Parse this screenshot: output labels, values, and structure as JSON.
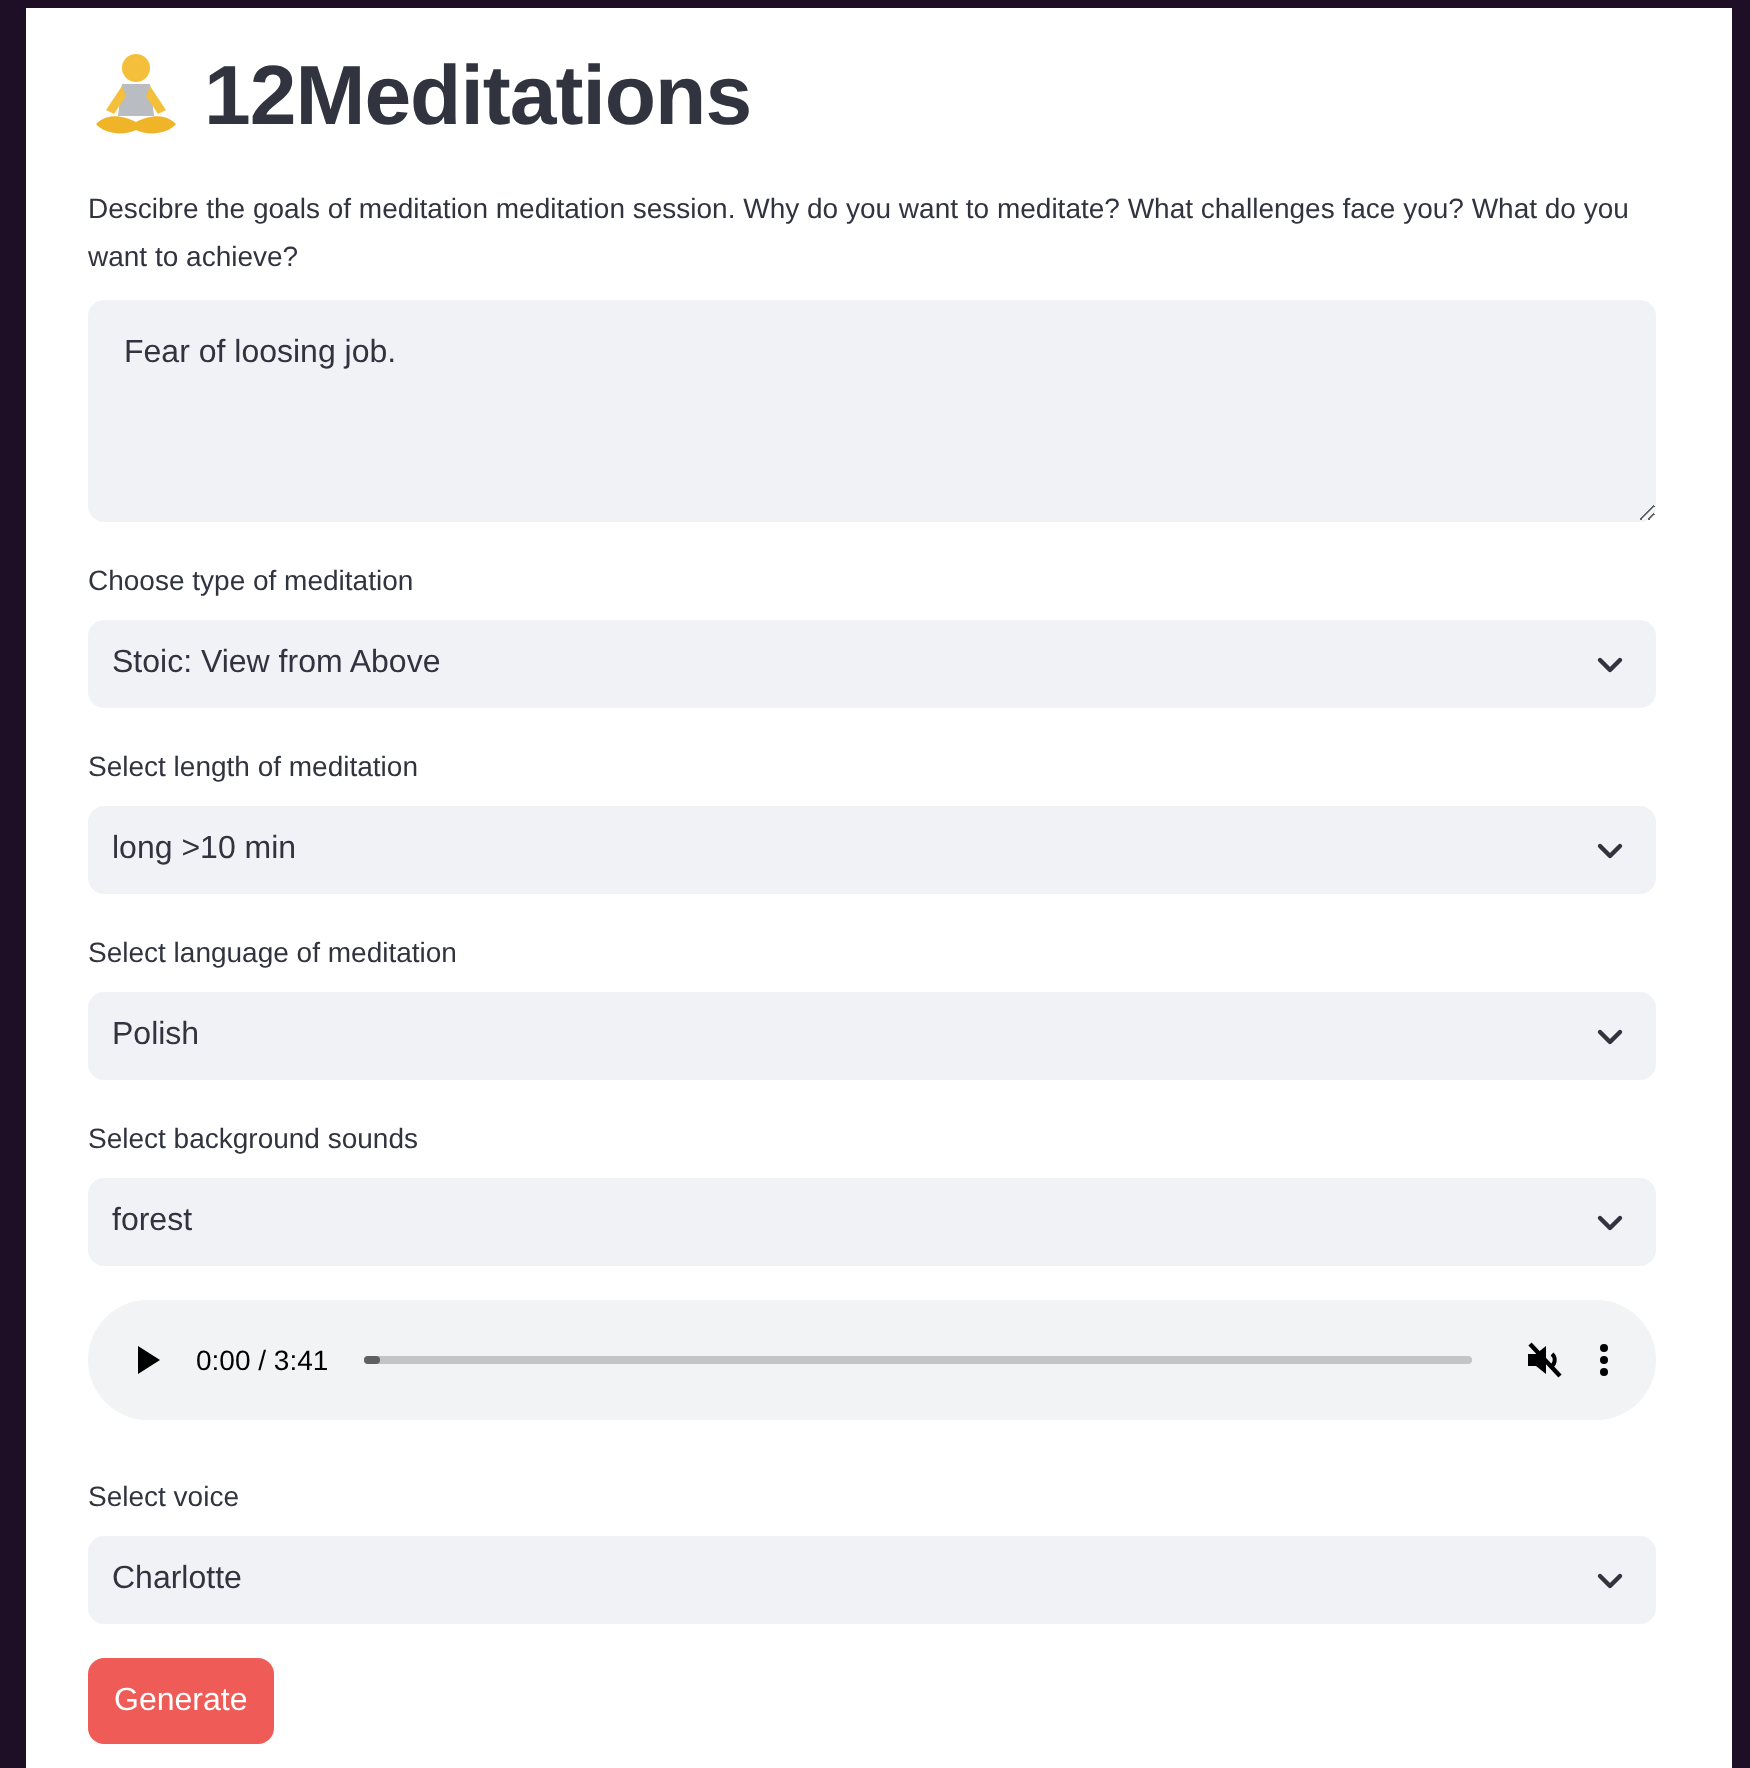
{
  "title": "12Meditations",
  "goals": {
    "label": "Descibre the goals of meditation meditation session. Why do you want to meditate? What challenges face you? What do you want to achieve?",
    "value": "Fear of loosing job."
  },
  "selects": [
    {
      "label": "Choose type of meditation",
      "value": "Stoic: View from Above"
    },
    {
      "label": "Select length of meditation",
      "value": "long >10 min"
    },
    {
      "label": "Select language of meditation",
      "value": "Polish"
    },
    {
      "label": "Select background sounds",
      "value": "forest"
    }
  ],
  "audio": {
    "time": "0:00 / 3:41",
    "level": 0.01,
    "muted": true
  },
  "voice": {
    "label": "Select voice",
    "value": "Charlotte"
  },
  "button": "Generate"
}
